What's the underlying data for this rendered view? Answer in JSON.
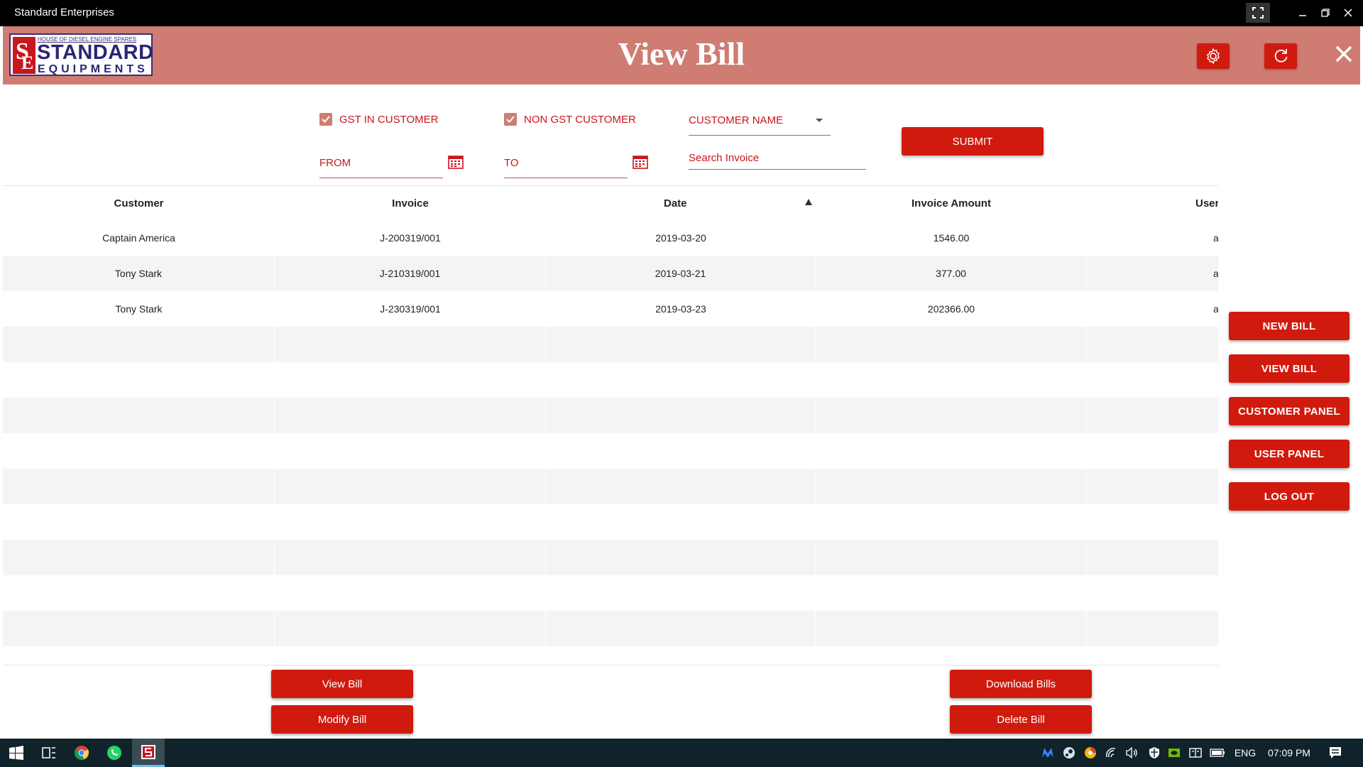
{
  "window": {
    "title": "Standard Enterprises"
  },
  "header": {
    "title": "View Bill",
    "logo": {
      "tagline": "HOUSE OF DIESEL ENGINE SPARES",
      "line1": "STANDARD",
      "line2": "EQUIPMENTS"
    },
    "color": "#cf7c72",
    "accent": "#d11a0e"
  },
  "filters": {
    "gst_in_customer": {
      "label": "GST IN CUSTOMER",
      "checked": true
    },
    "non_gst_customer": {
      "label": "NON GST CUSTOMER",
      "checked": true
    },
    "customer_name": {
      "label": "CUSTOMER NAME"
    },
    "from": {
      "label": "FROM"
    },
    "to": {
      "label": "TO"
    },
    "search_invoice": {
      "placeholder": "Search Invoice"
    },
    "submit_label": "SUBMIT"
  },
  "table": {
    "columns": [
      "Customer",
      "Invoice",
      "Date",
      "Invoice Amount",
      "User"
    ],
    "sort_column": "Date",
    "rows": [
      {
        "customer": "Captain America",
        "invoice": "J-200319/001",
        "date": "2019-03-20",
        "amount": "1546.00",
        "user": "ac"
      },
      {
        "customer": "Tony Stark",
        "invoice": "J-210319/001",
        "date": "2019-03-21",
        "amount": "377.00",
        "user": "ac"
      },
      {
        "customer": "Tony Stark",
        "invoice": "J-230319/001",
        "date": "2019-03-23",
        "amount": "202366.00",
        "user": "ac"
      }
    ]
  },
  "side_nav": {
    "new_bill": "NEW BILL",
    "view_bill": "VIEW BILL",
    "customer_panel": "CUSTOMER PANEL",
    "user_panel": "USER PANEL",
    "log_out": "LOG OUT"
  },
  "actions": {
    "view_bill": "View Bill",
    "modify_bill": "Modify Bill",
    "download_bills": "Download Bills",
    "delete_bill": "Delete Bill"
  },
  "taskbar": {
    "language": "ENG",
    "time": "07:09 PM"
  }
}
